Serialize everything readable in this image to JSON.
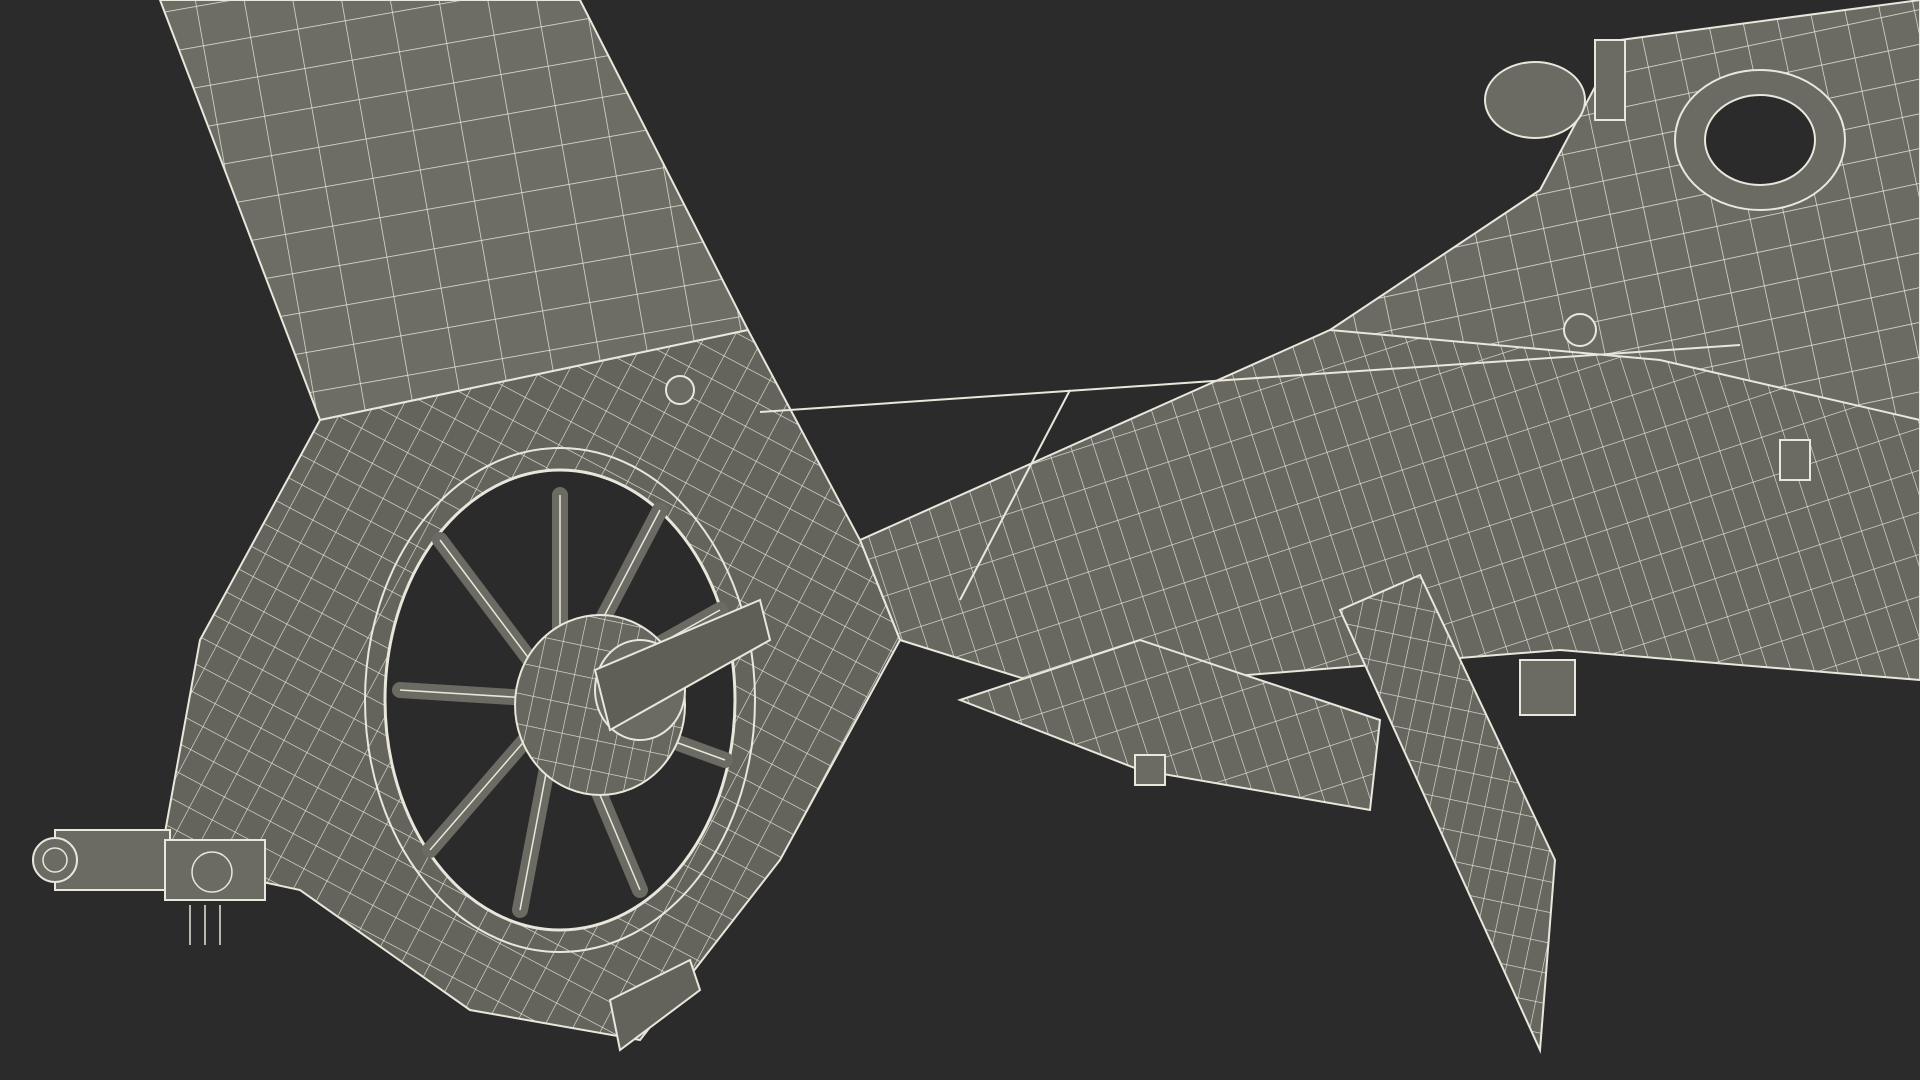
{
  "scene": {
    "background_color": "#2b2b2b",
    "surface_color": "#6b6b63",
    "surface_shade_color": "#5a5a53",
    "wire_color": "#e9e7dc",
    "subject": "helicopter-tail-wireframe"
  }
}
